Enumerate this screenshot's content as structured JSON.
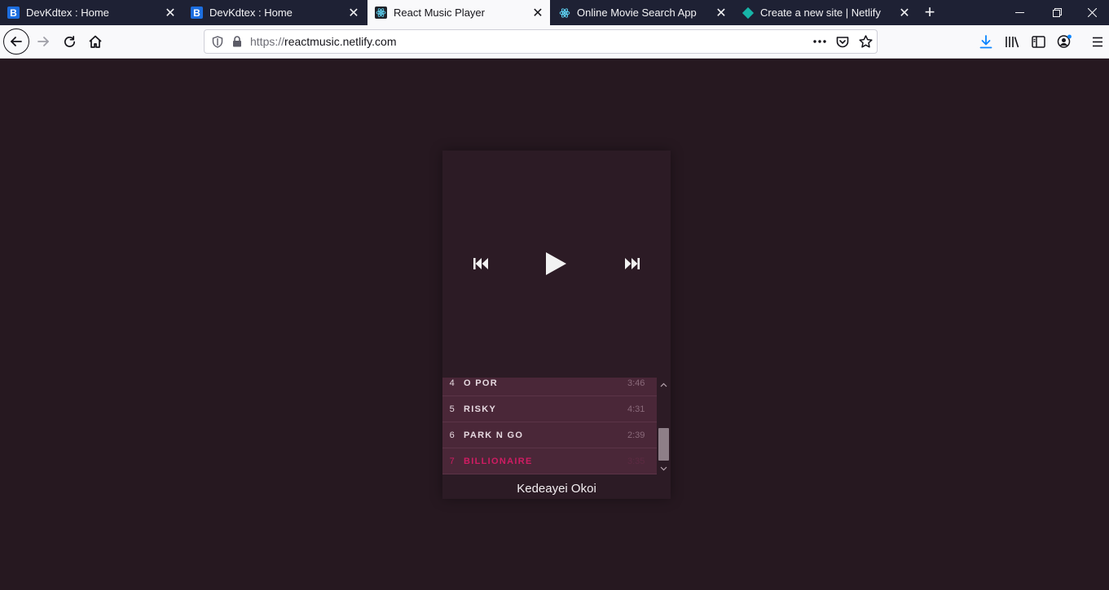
{
  "browser": {
    "tabs": [
      {
        "title": "DevKdtex : Home",
        "icon": "b-icon",
        "active": false
      },
      {
        "title": "DevKdtex : Home",
        "icon": "b-icon",
        "active": false
      },
      {
        "title": "React Music Player",
        "icon": "react-icon",
        "active": true
      },
      {
        "title": "Online Movie Search App",
        "icon": "react-icon",
        "active": false
      },
      {
        "title": "Create a new site | Netlify",
        "icon": "netlify-icon",
        "active": false
      }
    ],
    "url_protocol": "https://",
    "url_host": "reactmusic.netlify.com"
  },
  "player": {
    "controls": {
      "prev_icon": "skip-previous-icon",
      "play_icon": "play-icon",
      "next_icon": "skip-next-icon"
    },
    "tracks": [
      {
        "number": "4",
        "title": "O POR",
        "duration": "3:46",
        "current": false
      },
      {
        "number": "5",
        "title": "RISKY",
        "duration": "4:31",
        "current": false
      },
      {
        "number": "6",
        "title": "PARK N GO",
        "duration": "2:39",
        "current": false
      },
      {
        "number": "7",
        "title": "BILLIONAIRE",
        "duration": "3:35",
        "current": true
      }
    ],
    "artist": "Kedeayei Okoi"
  },
  "colors": {
    "page_background": "#261820",
    "player_background": "#2c1b25",
    "track_background": "#4a2738",
    "current_track": "#d01c63"
  }
}
